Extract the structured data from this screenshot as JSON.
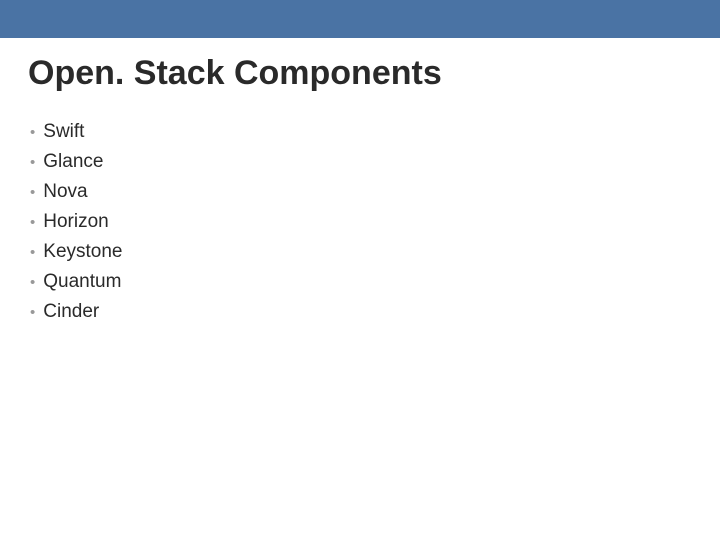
{
  "slide": {
    "title": "Open. Stack Components",
    "items": [
      "Swift",
      "Glance",
      "Nova",
      "Horizon",
      "Keystone",
      "Quantum",
      "Cinder"
    ]
  }
}
